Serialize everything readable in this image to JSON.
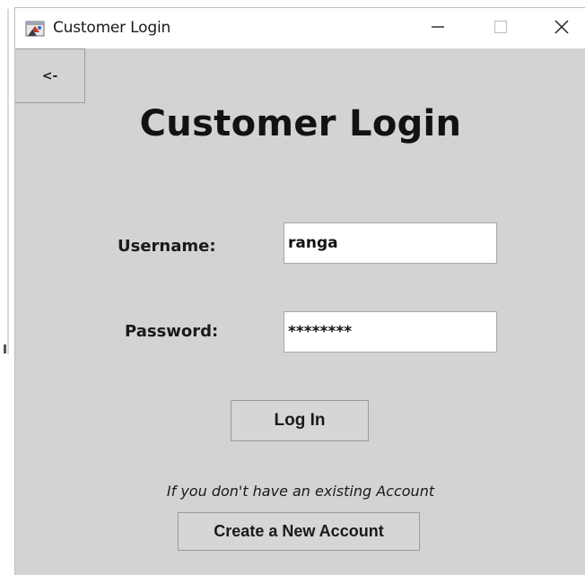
{
  "window": {
    "title": "Customer Login"
  },
  "icons": {
    "app": "java-app-icon",
    "minimize": "minimize-icon",
    "maximize": "maximize-icon",
    "close": "close-icon"
  },
  "nav": {
    "back_label": "<-"
  },
  "form": {
    "heading": "Customer Login",
    "username_label": "Username:",
    "username_value": "ranga",
    "password_label": "Password:",
    "password_mask": "********",
    "login_label": "Log In",
    "hint": "If you don't have an existing Account",
    "create_label": "Create a New Account"
  }
}
